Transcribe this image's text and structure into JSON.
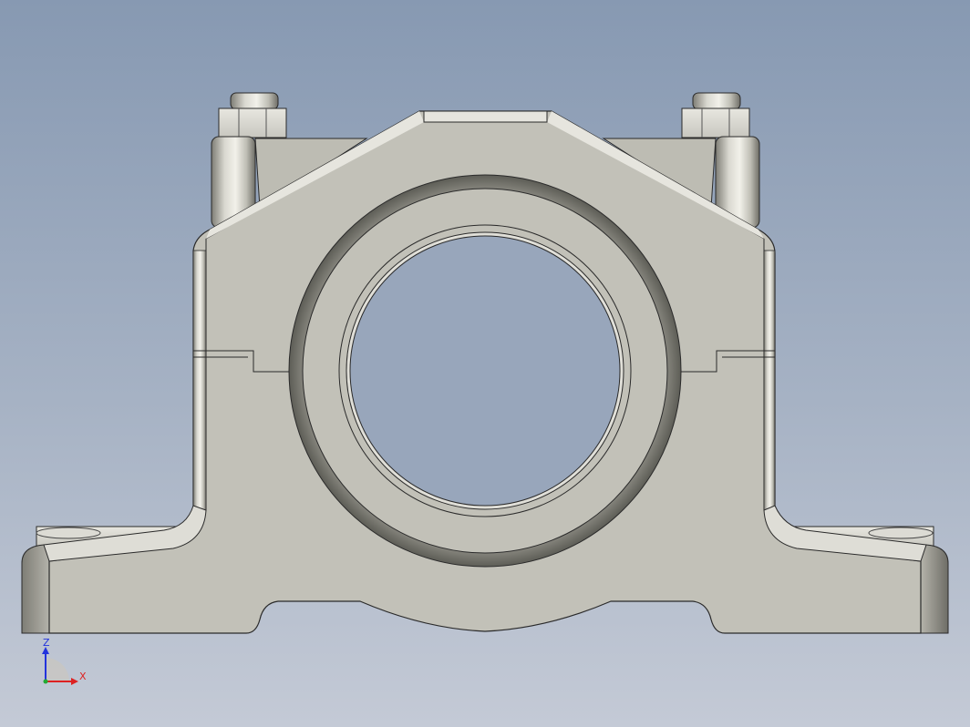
{
  "viewport": {
    "colors": {
      "background_top": "#8799b2",
      "background_bottom": "#c4cad6",
      "part_face": "#c2c1b8",
      "part_edge": "#2a2a2a"
    }
  },
  "model": {
    "part": "pillow-block-bearing-housing",
    "view": "front"
  },
  "triad": {
    "z_label": "Z",
    "x_label": "X",
    "colors": {
      "z": "#2233dd",
      "x": "#dd2222",
      "y": "#22aa33"
    }
  }
}
